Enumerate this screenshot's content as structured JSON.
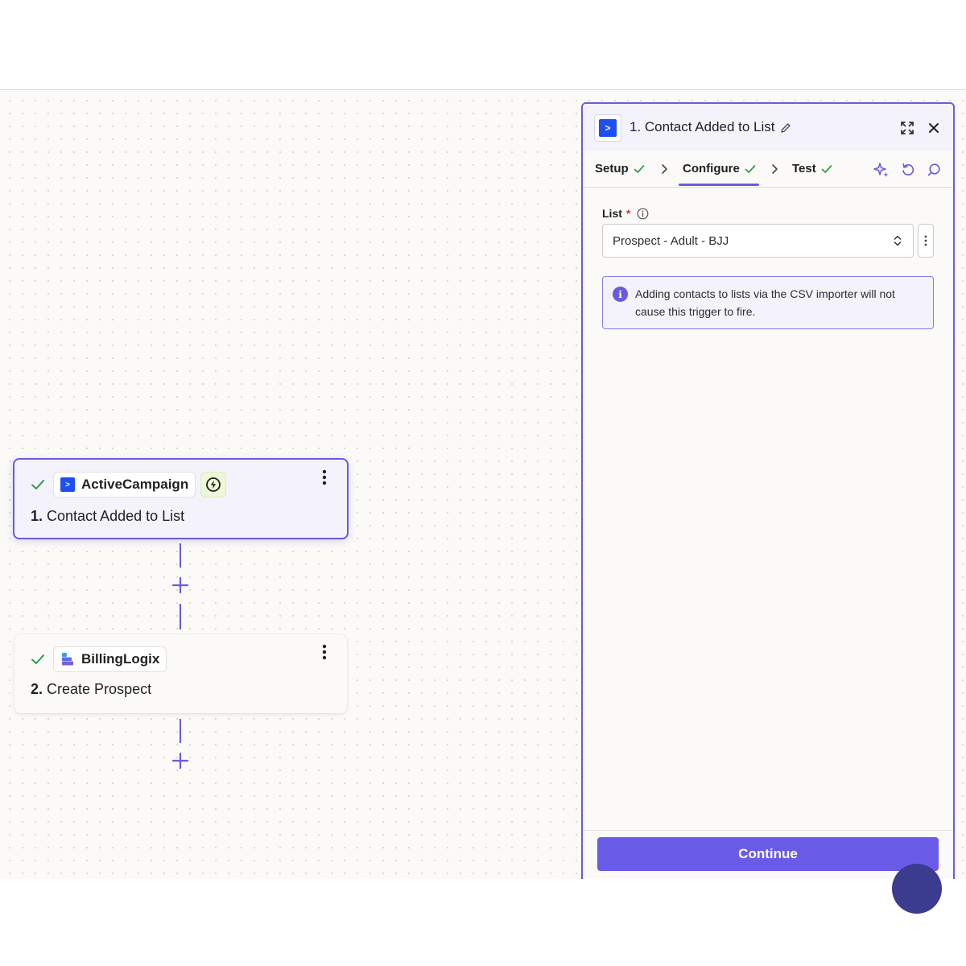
{
  "workflow": {
    "steps": [
      {
        "number": "1.",
        "title": "Contact Added to List",
        "app": "ActiveCampaign",
        "status": "complete",
        "is_trigger": true,
        "selected": true
      },
      {
        "number": "2.",
        "title": "Create Prospect",
        "app": "BillingLogix",
        "status": "complete",
        "is_trigger": false,
        "selected": false
      }
    ]
  },
  "panel": {
    "title": "1. Contact Added to List",
    "tabs": [
      {
        "label": "Setup",
        "complete": true
      },
      {
        "label": "Configure",
        "complete": true,
        "active": true
      },
      {
        "label": "Test",
        "complete": true
      }
    ],
    "list_field": {
      "label": "List",
      "required_mark": "*",
      "value": "Prospect - Adult - BJJ"
    },
    "notice": "Adding contacts to lists via the CSV importer will not cause this trigger to fire.",
    "continue_label": "Continue"
  },
  "colors": {
    "accent": "#6a5ae0",
    "check": "#2e9b4a",
    "activecampaign": "#1d4ff2"
  },
  "icons": [
    "check-icon",
    "trigger-icon",
    "kebab-icon",
    "plus-icon",
    "expand-icon",
    "close-icon",
    "pencil-icon",
    "chevron-right-icon",
    "sparkle-icon",
    "undo-icon",
    "comment-icon",
    "info-icon",
    "sort-arrows-icon"
  ]
}
